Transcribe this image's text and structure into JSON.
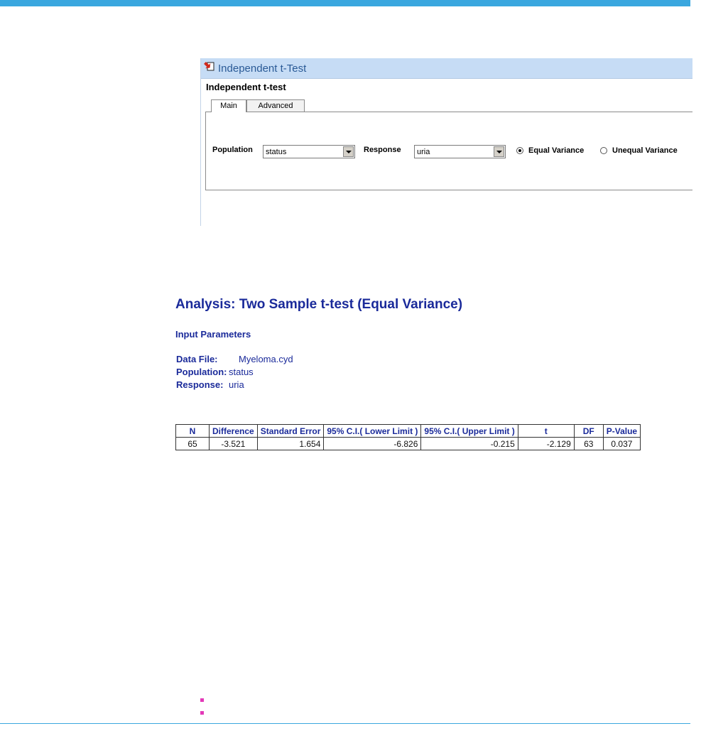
{
  "dialog": {
    "title": "Independent t-Test",
    "subtitle": "Independent t-test",
    "tabs": [
      {
        "label": "Main",
        "selected": true
      },
      {
        "label": "Advanced",
        "selected": false
      }
    ],
    "population": {
      "label": "Population",
      "value": "status"
    },
    "response": {
      "label": "Response",
      "value": "uria"
    },
    "variance_options": [
      {
        "label": "Equal Variance",
        "selected": true
      },
      {
        "label": "Unequal Variance",
        "selected": false
      }
    ]
  },
  "report": {
    "title": "Analysis: Two Sample t-test (Equal Variance)",
    "input_section": "Input Parameters",
    "params": [
      {
        "key": "Data File:",
        "value": "Myeloma.cyd"
      },
      {
        "key": "Population:",
        "value": "status"
      },
      {
        "key": "Response:",
        "value": "uria"
      }
    ],
    "table": {
      "headers": [
        "N",
        "Difference",
        "Standard Error",
        "95% C.I.( Lower Limit )",
        "95% C.I.( Upper Limit )",
        "t",
        "DF",
        "P-Value"
      ],
      "row": [
        "65",
        "-3.521",
        "1.654",
        "-6.826",
        "-0.215",
        "-2.129",
        "63",
        "0.037"
      ]
    }
  },
  "colors": {
    "accent_bar": "#3aa7df",
    "report_blue": "#1a2a9a",
    "bullet": "#e339b8"
  }
}
